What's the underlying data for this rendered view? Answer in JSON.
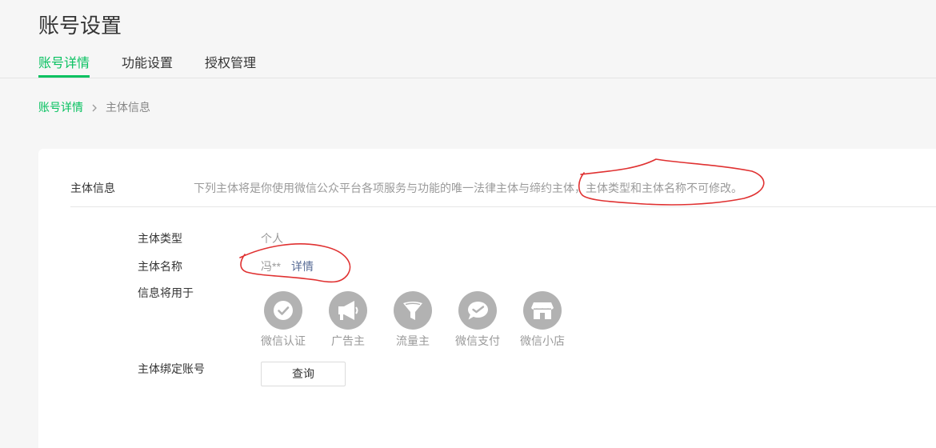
{
  "page": {
    "title": "账号设置"
  },
  "tabs": [
    {
      "label": "账号详情",
      "active": true
    },
    {
      "label": "功能设置",
      "active": false
    },
    {
      "label": "授权管理",
      "active": false
    }
  ],
  "breadcrumb": {
    "root": "账号详情",
    "separator_icon": "chevron-right-icon",
    "current": "主体信息"
  },
  "section": {
    "title": "主体信息",
    "description": "下列主体将是你使用微信公众平台各项服务与功能的唯一法律主体与缔约主体，主体类型和主体名称不可修改。"
  },
  "fields": {
    "type": {
      "label": "主体类型",
      "value": "个人"
    },
    "name": {
      "label": "主体名称",
      "value": "冯**",
      "link": "详情"
    },
    "usage": {
      "label": "信息将用于",
      "items": [
        {
          "label": "微信认证",
          "icon": "verified-check-icon"
        },
        {
          "label": "广告主",
          "icon": "megaphone-icon"
        },
        {
          "label": "流量主",
          "icon": "funnel-icon"
        },
        {
          "label": "微信支付",
          "icon": "wechat-pay-icon"
        },
        {
          "label": "微信小店",
          "icon": "shop-icon"
        }
      ]
    },
    "bound": {
      "label": "主体绑定账号",
      "button": "查询"
    }
  },
  "colors": {
    "accent": "#07c160",
    "link": "#576b95",
    "icon_bg": "#b2b2b2",
    "annotation": "#e03131"
  }
}
